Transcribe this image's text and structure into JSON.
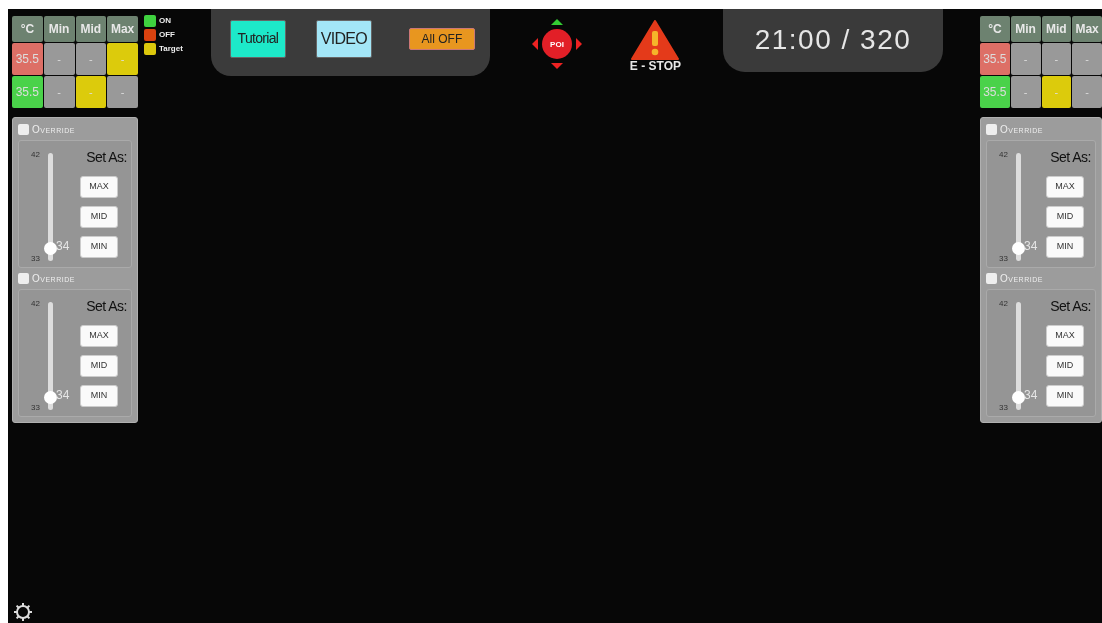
{
  "legend": [
    {
      "label": "ON",
      "color": "#3fd23f"
    },
    {
      "label": "OFF",
      "color": "#d9420f"
    },
    {
      "label": "Target",
      "color": "#dcc80c"
    }
  ],
  "toolbar": [
    {
      "label": "Tutorial",
      "kind": "tutorial"
    },
    {
      "label": "VIDEO",
      "kind": "video"
    },
    {
      "label": "All OFF",
      "kind": "alloff"
    }
  ],
  "poi": {
    "label": "POI"
  },
  "estop": {
    "label": "E - STOP"
  },
  "clock": {
    "text": "21:00 / 320"
  },
  "zones": [
    {
      "columns": [
        "°C",
        "Min",
        "Mid",
        "Max"
      ],
      "rows": [
        {
          "cells": [
            {
              "text": "35.5",
              "color": "#dd6f66"
            },
            {
              "text": "-",
              "target": false
            },
            {
              "text": "-",
              "target": false
            },
            {
              "text": "-",
              "target": true
            }
          ]
        },
        {
          "cells": [
            {
              "text": "35.5",
              "color": "#4ad24a"
            },
            {
              "text": "-",
              "target": false
            },
            {
              "text": "-",
              "target": true
            },
            {
              "text": "-",
              "target": false
            }
          ]
        }
      ],
      "overrides": [
        {
          "label": "Override",
          "checked": false,
          "set_as": "Set As:",
          "buttons": [
            "MAX",
            "MID",
            "MIN"
          ],
          "max": "42",
          "min": "33",
          "value": "34",
          "level": 0.11
        },
        {
          "label": "Override",
          "checked": false,
          "set_as": "Set As:",
          "buttons": [
            "MAX",
            "MID",
            "MIN"
          ],
          "max": "42",
          "min": "33",
          "value": "34",
          "level": 0.11
        }
      ]
    },
    {
      "columns": [
        "°C",
        "Min",
        "Mid",
        "Max"
      ],
      "rows": [
        {
          "cells": [
            {
              "text": "35.5",
              "color": "#dd6f66"
            },
            {
              "text": "-",
              "target": false
            },
            {
              "text": "-",
              "target": false
            },
            {
              "text": "-",
              "target": false
            }
          ]
        },
        {
          "cells": [
            {
              "text": "35.5",
              "color": "#4ad24a"
            },
            {
              "text": "-",
              "target": false
            },
            {
              "text": "-",
              "target": true
            },
            {
              "text": "-",
              "target": false
            }
          ]
        }
      ],
      "overrides": [
        {
          "label": "Override",
          "checked": false,
          "set_as": "Set As:",
          "buttons": [
            "MAX",
            "MID",
            "MIN"
          ],
          "max": "42",
          "min": "33",
          "value": "34",
          "level": 0.11
        },
        {
          "label": "Override",
          "checked": false,
          "set_as": "Set As:",
          "buttons": [
            "MAX",
            "MID",
            "MIN"
          ],
          "max": "42",
          "min": "33",
          "value": "34",
          "level": 0.11
        }
      ]
    }
  ]
}
